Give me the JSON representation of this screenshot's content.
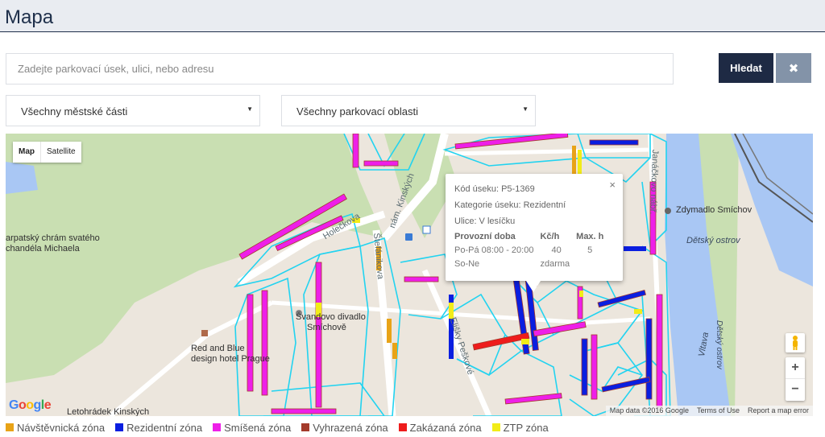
{
  "header": {
    "title": "Mapa"
  },
  "search": {
    "placeholder": "Zadejte parkovací úsek, ulici, nebo adresu",
    "submit_label": "Hledat",
    "clear_icon": "close-icon",
    "clear_glyph": "✖"
  },
  "filters": {
    "district": {
      "selected": "Všechny městské části"
    },
    "parking_area": {
      "selected": "Všechny parkovací oblasti"
    },
    "caret_glyph": "▼"
  },
  "map": {
    "type_buttons": [
      {
        "label": "Map",
        "active": true
      },
      {
        "label": "Satellite",
        "active": false
      }
    ],
    "labels": {
      "chram_line1": "arpatský chrám svatého",
      "chram_line2": "chandéla Michaela",
      "holeckova": "Holečkova",
      "nam_kinskych": "nám. Kinských",
      "stefanikova": "Štefánikova",
      "svandovo_line1": "Švandovo divadlo",
      "svandovo_line2": "Smíchově",
      "hotel_line1": "Red and Blue",
      "hotel_line2": "design hotel Prague",
      "letohradek": "Letohrádek Kinských",
      "plzenska": "Elišky Peškové",
      "janackovo": "Janáčkovo nábř.",
      "zdymadlo": "Zdymadlo Smíchov",
      "detsky_ostrov": "Dětský ostrov",
      "detsky_ostrov_vertical": "Dětský ostrov",
      "vltava": "Vltava"
    },
    "popup": {
      "code": "Kód úseku: P5-1369",
      "category": "Kategorie úseku: Rezidentní",
      "street": "Ulice: V lesíčku",
      "table_headers": [
        "Provozní doba",
        "Kč/h",
        "Max. h"
      ],
      "rows": [
        [
          "Po-Pá 08:00 - 20:00",
          "40",
          "5"
        ],
        [
          "So-Ne",
          "zdarma",
          ""
        ]
      ],
      "close_glyph": "×"
    },
    "zoom": {
      "in": "+",
      "out": "−"
    },
    "attribution": [
      "Map data ©2016 Google",
      "Terms of Use",
      "Report a map error"
    ],
    "google_logo": "Google"
  },
  "legend": [
    {
      "label": "Návštěvnická zóna",
      "color": "#e8a317"
    },
    {
      "label": "Rezidentní zóna",
      "color": "#0a1ee0"
    },
    {
      "label": "Smíšená zóna",
      "color": "#ee1fe8"
    },
    {
      "label": "Vyhrazená zóna",
      "color": "#a33a2b"
    },
    {
      "label": "Zakázaná zóna",
      "color": "#ee1c1c"
    },
    {
      "label": "ZTP zóna",
      "color": "#f2ec18"
    }
  ],
  "colors": {
    "zone_border": "#22d3f0",
    "park": "#c9dfb2",
    "water": "#a9c7f4"
  }
}
